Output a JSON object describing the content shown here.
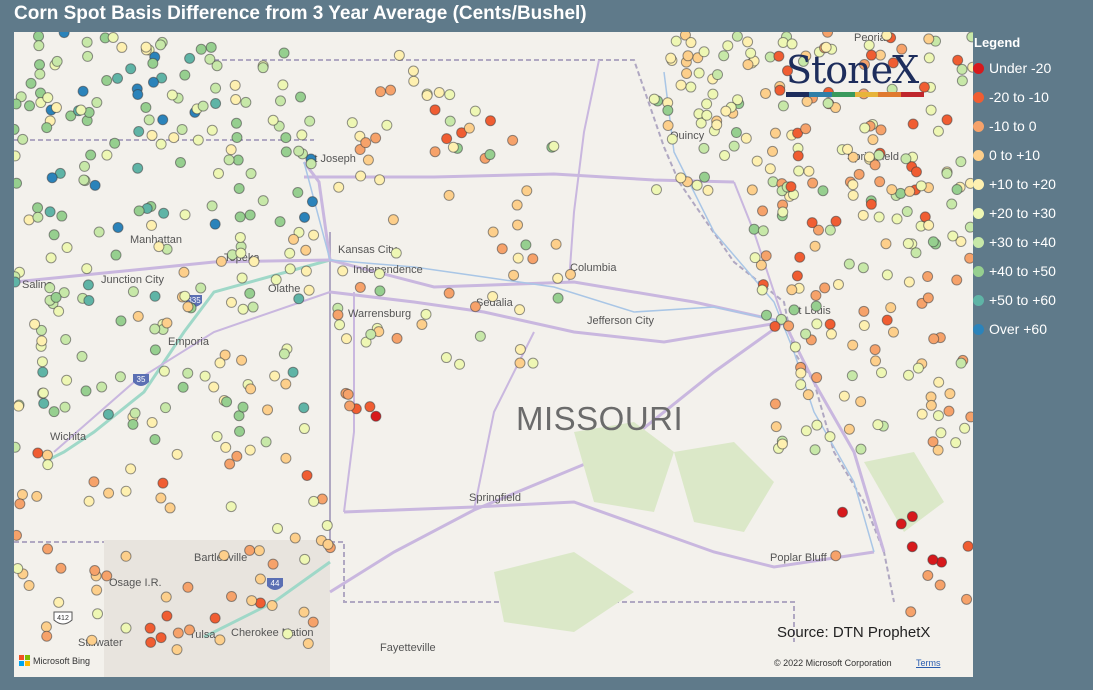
{
  "title": "Corn Spot Basis Difference from 3 Year Average (Cents/Bushel)",
  "map": {
    "state_label": "MISSOURI",
    "source": "Source: DTN ProphetX",
    "copyright": "© 2022 Microsoft Corporation",
    "terms": "Terms",
    "provider": "Microsoft Bing",
    "cities": [
      "St Joseph",
      "Manhattan",
      "Junction City",
      "Salina",
      "Topeka",
      "Kansas City",
      "Independence",
      "Olathe",
      "Columbia",
      "Sedalia",
      "Warrensburg",
      "Jefferson City",
      "St Louis",
      "Emporia",
      "Wichita",
      "Springfield",
      "Springfield",
      "Bartlesville",
      "Osage I.R.",
      "Tulsa",
      "Cherokee Nation",
      "Stillwater",
      "Fayetteville",
      "Poplar Bluff",
      "Peoria",
      "Quincy"
    ],
    "highway_shields": [
      "335",
      "35",
      "44",
      "412"
    ]
  },
  "logo": {
    "text": "StoneX",
    "bar_colors": [
      "#1d2d5c",
      "#2f7fa8",
      "#3a9a5c",
      "#e7b43a",
      "#e07a2f",
      "#c0272d"
    ]
  },
  "legend": {
    "title": "Legend",
    "items": [
      {
        "label": "Under -20",
        "color": "#d7191c"
      },
      {
        "label": "-20 to -10",
        "color": "#f05d32"
      },
      {
        "label": "-10 to 0",
        "color": "#f6a26a"
      },
      {
        "label": "0 to +10",
        "color": "#fdcf8b"
      },
      {
        "label": "+10 to +20",
        "color": "#fef0b0"
      },
      {
        "label": "+20 to +30",
        "color": "#eef7b4"
      },
      {
        "label": "+30 to +40",
        "color": "#c7e8a8"
      },
      {
        "label": "+40 to +50",
        "color": "#96cf8f"
      },
      {
        "label": "+50 to +60",
        "color": "#5fb4a6"
      },
      {
        "label": "Over +60",
        "color": "#2b83ba"
      }
    ]
  }
}
